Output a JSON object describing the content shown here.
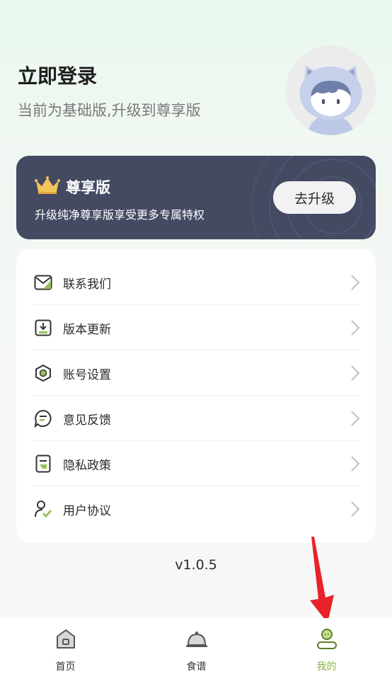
{
  "header": {
    "title": "立即登录",
    "subtitle": "当前为基础版,升级到尊享版"
  },
  "vip": {
    "title": "尊享版",
    "description": "升级纯净尊享版享受更多专属特权",
    "button_label": "去升级"
  },
  "menu": {
    "items": [
      {
        "label": "联系我们",
        "icon": "mail-icon"
      },
      {
        "label": "版本更新",
        "icon": "download-icon"
      },
      {
        "label": "账号设置",
        "icon": "settings-icon"
      },
      {
        "label": "意见反馈",
        "icon": "feedback-icon"
      },
      {
        "label": "隐私政策",
        "icon": "document-icon"
      },
      {
        "label": "用户协议",
        "icon": "user-check-icon"
      }
    ]
  },
  "version": "v1.0.5",
  "tabbar": {
    "tabs": [
      {
        "label": "首页",
        "icon": "home-icon"
      },
      {
        "label": "食谱",
        "icon": "dish-cover-icon"
      },
      {
        "label": "我的",
        "icon": "profile-icon",
        "active": true
      }
    ],
    "active_color": "#8bb34a"
  },
  "colors": {
    "vip_card": "#454a63",
    "accent_green": "#8bb34a",
    "arrow_red": "#e8222a"
  }
}
